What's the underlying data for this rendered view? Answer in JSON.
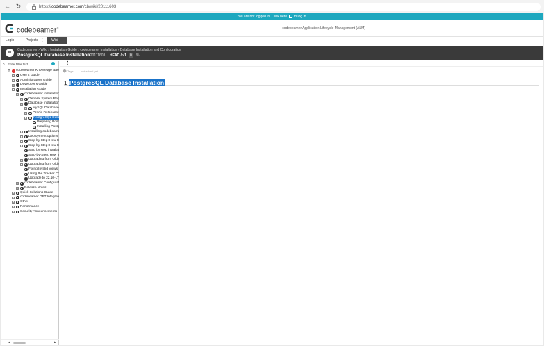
{
  "browser": {
    "back_icon": "arrow-left-icon",
    "reload_icon": "reload-icon",
    "url_scheme": "https://",
    "url_host": "codebeamer.com",
    "url_path": "/cb/wiki/20111603"
  },
  "banner": {
    "text_before": "You are not logged in. Click here",
    "text_after": "to log in."
  },
  "brand": {
    "name": "codebeamer",
    "mark": "®",
    "product_title": "codebeamer Application Lifecycle Management (ALM)",
    "accent_color": "#1ea8bf"
  },
  "tabs": [
    {
      "label": "Login",
      "sep": "⋮"
    },
    {
      "label": "Projects",
      "sep": "⋮"
    },
    {
      "label": "Wiki",
      "sep": "⋮"
    }
  ],
  "header": {
    "avatar": "W",
    "breadcrumb": "Codebeamer › Wiki › Installation Guide › codebeamer Installation › Database Installation and Configuration",
    "title": "PostgreSQL Database Installation",
    "id": "#20111603",
    "version": "HEAD / v1",
    "count": "0",
    "link_icon": "%"
  },
  "tree": {
    "filter_placeholder": "Enter filter text",
    "items": [
      {
        "label": "codebeamer Knowledge Base",
        "toggle": "⊟"
      },
      {
        "label": "User's Guide",
        "toggle": "+"
      },
      {
        "label": "Administrator's Guide",
        "toggle": "+"
      },
      {
        "label": "Developer's Guide",
        "toggle": "+"
      },
      {
        "label": "Installation Guide",
        "toggle": "−"
      },
      {
        "label": "codebeamer Installation",
        "toggle": "−"
      },
      {
        "label": "General System Requirements",
        "toggle": "+"
      },
      {
        "label": "Database Installation and Configuration",
        "toggle": "−"
      },
      {
        "label": "MySQL Database Installation",
        "toggle": "+"
      },
      {
        "label": "Oracle Database Installation",
        "toggle": "+"
      },
      {
        "label": "PostgreSQL Database Installation",
        "toggle": "−"
      },
      {
        "label": "Preparing PostgreSQL",
        "toggle": ""
      },
      {
        "label": "Installing PostgreSQL",
        "toggle": ""
      },
      {
        "label": "Installing codebeamer",
        "toggle": "+"
      },
      {
        "label": "Deployment options",
        "toggle": "+"
      },
      {
        "label": "Step by Step: How to install",
        "toggle": "+"
      },
      {
        "label": "Step by Step: How to upgrade",
        "toggle": "+"
      },
      {
        "label": "Step by step installation",
        "toggle": ""
      },
      {
        "label": "Step-by-Step: How to",
        "toggle": ""
      },
      {
        "label": "Upgrading from Older Versions",
        "toggle": "+"
      },
      {
        "label": "Upgrading from Older Releases",
        "toggle": "+"
      },
      {
        "label": "Fixing Invalid Views",
        "toggle": ""
      },
      {
        "label": "Using the Tracker Configuration",
        "toggle": ""
      },
      {
        "label": "Upgrade to 22.10-LTS",
        "toggle": ""
      },
      {
        "label": "codebeamer Configuration",
        "toggle": "+"
      },
      {
        "label": "Release Notes",
        "toggle": "+"
      },
      {
        "label": "Quick Solutions Guide",
        "toggle": "+"
      },
      {
        "label": "codebeamer DPT Integration",
        "toggle": "+"
      },
      {
        "label": "Other",
        "toggle": "+"
      },
      {
        "label": "Performance",
        "toggle": "+"
      },
      {
        "label": "Security Announcements",
        "toggle": "+"
      }
    ]
  },
  "content": {
    "tags_label": "Tags:",
    "tags_value": "not added yet",
    "heading_number": "1",
    "heading_text": "PostgreSQL Database Installation"
  }
}
